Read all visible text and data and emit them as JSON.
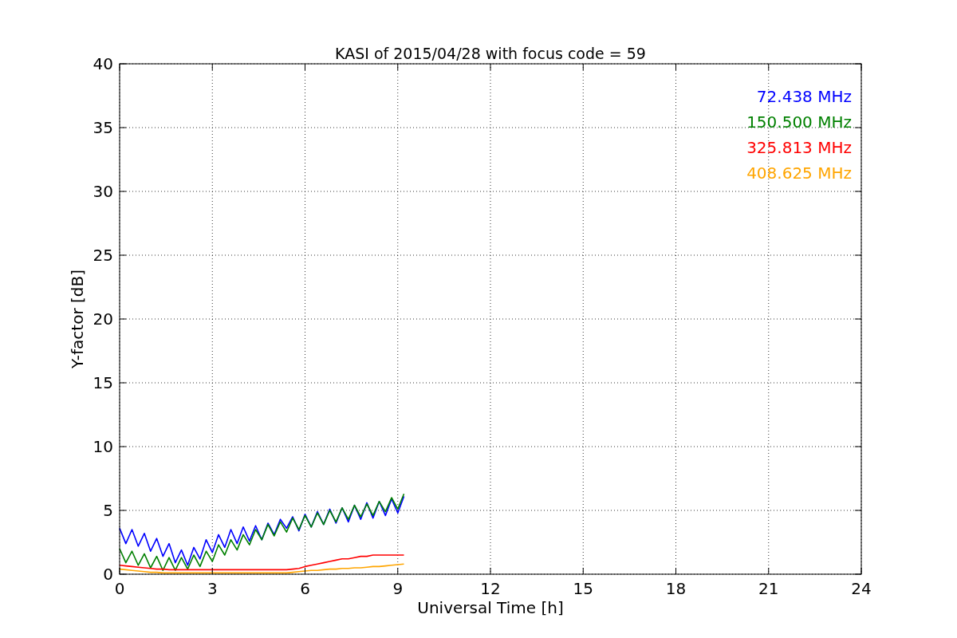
{
  "chart_data": {
    "type": "line",
    "title": "KASI of 2015/04/28 with focus code = 59",
    "xlabel": "Universal Time [h]",
    "ylabel": "Y-factor [dB]",
    "grid": true,
    "xlim": [
      0,
      24
    ],
    "ylim": [
      0,
      40
    ],
    "xticks": [
      0,
      3,
      6,
      9,
      12,
      15,
      18,
      21,
      24
    ],
    "yticks": [
      0,
      5,
      10,
      15,
      20,
      25,
      30,
      35,
      40
    ],
    "x": [
      0,
      0.2,
      0.4,
      0.6,
      0.8,
      1.0,
      1.2,
      1.4,
      1.6,
      1.8,
      2.0,
      2.2,
      2.4,
      2.6,
      2.8,
      3.0,
      3.2,
      3.4,
      3.6,
      3.8,
      4.0,
      4.2,
      4.4,
      4.6,
      4.8,
      5.0,
      5.2,
      5.4,
      5.6,
      5.8,
      6.0,
      6.2,
      6.4,
      6.6,
      6.8,
      7.0,
      7.2,
      7.4,
      7.6,
      7.8,
      8.0,
      8.2,
      8.4,
      8.6,
      8.8,
      9.0,
      9.2
    ],
    "series": [
      {
        "name": "72.438 MHz",
        "color": "#0000ff",
        "values": [
          3.6,
          2.4,
          3.5,
          2.2,
          3.2,
          1.8,
          2.8,
          1.4,
          2.4,
          0.9,
          1.9,
          0.7,
          2.1,
          1.2,
          2.7,
          1.7,
          3.1,
          2.1,
          3.5,
          2.4,
          3.7,
          2.6,
          3.8,
          2.7,
          4.0,
          3.1,
          4.3,
          3.6,
          4.5,
          3.4,
          4.7,
          3.7,
          4.9,
          3.9,
          5.1,
          4.0,
          5.2,
          4.1,
          5.4,
          4.3,
          5.6,
          4.4,
          5.7,
          4.6,
          5.9,
          4.8,
          6.1
        ]
      },
      {
        "name": "150.500 MHz",
        "color": "#008000",
        "values": [
          2.0,
          0.9,
          1.8,
          0.7,
          1.6,
          0.5,
          1.4,
          0.3,
          1.3,
          0.3,
          1.3,
          0.4,
          1.5,
          0.6,
          1.8,
          1.0,
          2.3,
          1.5,
          2.7,
          1.9,
          3.1,
          2.3,
          3.5,
          2.7,
          3.9,
          3.0,
          4.1,
          3.3,
          4.4,
          3.5,
          4.6,
          3.7,
          4.8,
          3.9,
          5.0,
          4.1,
          5.2,
          4.3,
          5.4,
          4.5,
          5.5,
          4.6,
          5.7,
          4.9,
          6.0,
          5.1,
          6.3
        ]
      },
      {
        "name": "325.813 MHz",
        "color": "#ff0000",
        "values": [
          0.7,
          0.65,
          0.6,
          0.55,
          0.5,
          0.45,
          0.4,
          0.4,
          0.35,
          0.35,
          0.35,
          0.35,
          0.35,
          0.35,
          0.35,
          0.35,
          0.35,
          0.35,
          0.35,
          0.35,
          0.35,
          0.35,
          0.35,
          0.35,
          0.35,
          0.35,
          0.35,
          0.35,
          0.4,
          0.45,
          0.6,
          0.7,
          0.8,
          0.9,
          1.0,
          1.1,
          1.2,
          1.2,
          1.3,
          1.4,
          1.4,
          1.5,
          1.5,
          1.5,
          1.5,
          1.5,
          1.5
        ]
      },
      {
        "name": "408.625 MHz",
        "color": "#ffa500",
        "values": [
          0.4,
          0.35,
          0.3,
          0.25,
          0.2,
          0.15,
          0.15,
          0.1,
          0.1,
          0.1,
          0.1,
          0.1,
          0.1,
          0.1,
          0.1,
          0.1,
          0.1,
          0.1,
          0.1,
          0.1,
          0.1,
          0.1,
          0.1,
          0.1,
          0.1,
          0.1,
          0.1,
          0.1,
          0.15,
          0.2,
          0.25,
          0.3,
          0.3,
          0.35,
          0.4,
          0.4,
          0.45,
          0.45,
          0.5,
          0.5,
          0.55,
          0.6,
          0.6,
          0.65,
          0.7,
          0.75,
          0.8
        ]
      }
    ]
  }
}
